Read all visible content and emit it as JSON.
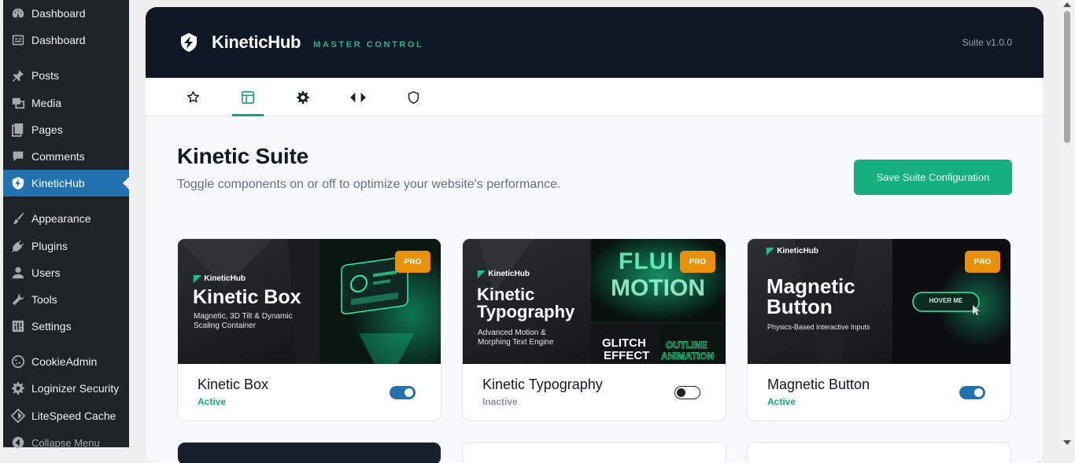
{
  "sidebar": {
    "items": [
      {
        "label": "Dashboard",
        "icon": "dashboard-icon"
      },
      {
        "label": "Dashboard",
        "icon": "dashboard-alt-icon"
      },
      {
        "label": "Posts",
        "icon": "pin-icon"
      },
      {
        "label": "Media",
        "icon": "media-icon"
      },
      {
        "label": "Pages",
        "icon": "pages-icon"
      },
      {
        "label": "Comments",
        "icon": "comment-icon"
      },
      {
        "label": "KineticHub",
        "icon": "kinetichub-icon"
      },
      {
        "label": "Appearance",
        "icon": "brush-icon"
      },
      {
        "label": "Plugins",
        "icon": "plugin-icon"
      },
      {
        "label": "Users",
        "icon": "user-icon"
      },
      {
        "label": "Tools",
        "icon": "wrench-icon"
      },
      {
        "label": "Settings",
        "icon": "settings-icon"
      },
      {
        "label": "CookieAdmin",
        "icon": "cookie-icon"
      },
      {
        "label": "Loginizer Security",
        "icon": "gear-icon"
      },
      {
        "label": "LiteSpeed Cache",
        "icon": "diamond-icon"
      },
      {
        "label": "Collapse Menu",
        "icon": "collapse-icon"
      }
    ]
  },
  "header": {
    "brand": "KineticHub",
    "tagline": "MASTER CONTROL",
    "version": "Suite v1.0.0"
  },
  "tabs": [
    {
      "icon": "star-icon"
    },
    {
      "icon": "layout-icon"
    },
    {
      "icon": "gear-icon"
    },
    {
      "icon": "code-icon"
    },
    {
      "icon": "shield-icon"
    }
  ],
  "main": {
    "title": "Kinetic Suite",
    "subtitle": "Toggle components on or off to optimize your website's performance.",
    "save_label": "Save Suite Configuration"
  },
  "components": [
    {
      "name": "Kinetic Box",
      "status": "Active",
      "enabled": true,
      "badge": "PRO",
      "thumb_logo": "KineticHub",
      "thumb_title": "Kinetic Box",
      "thumb_desc": "Magnetic, 3D Tilt & Dynamic Scaling Container"
    },
    {
      "name": "Kinetic Typography",
      "status": "Inactive",
      "enabled": false,
      "badge": "PRO",
      "thumb_logo": "KineticHub",
      "thumb_title": "Kinetic Typography",
      "thumb_desc": "Advanced Motion & Morphing Text Engine",
      "thumb_art": [
        "FLUI MOTION",
        "GLITCH EFFECT",
        "OUTLINE ANIMATION"
      ]
    },
    {
      "name": "Magnetic Button",
      "status": "Active",
      "enabled": true,
      "badge": "PRO",
      "thumb_logo": "KineticHub",
      "thumb_title": "Magnetic Button",
      "thumb_desc": "Physics-Based Interactive Inputs",
      "thumb_button": "HOVER ME"
    }
  ],
  "colors": {
    "accent": "#14b17f",
    "wp_blue": "#2271b1",
    "header_bg": "#0e1726",
    "pro_badge": "#e8900c",
    "active_text": "#14b17f",
    "inactive_text": "#8a94a6"
  }
}
